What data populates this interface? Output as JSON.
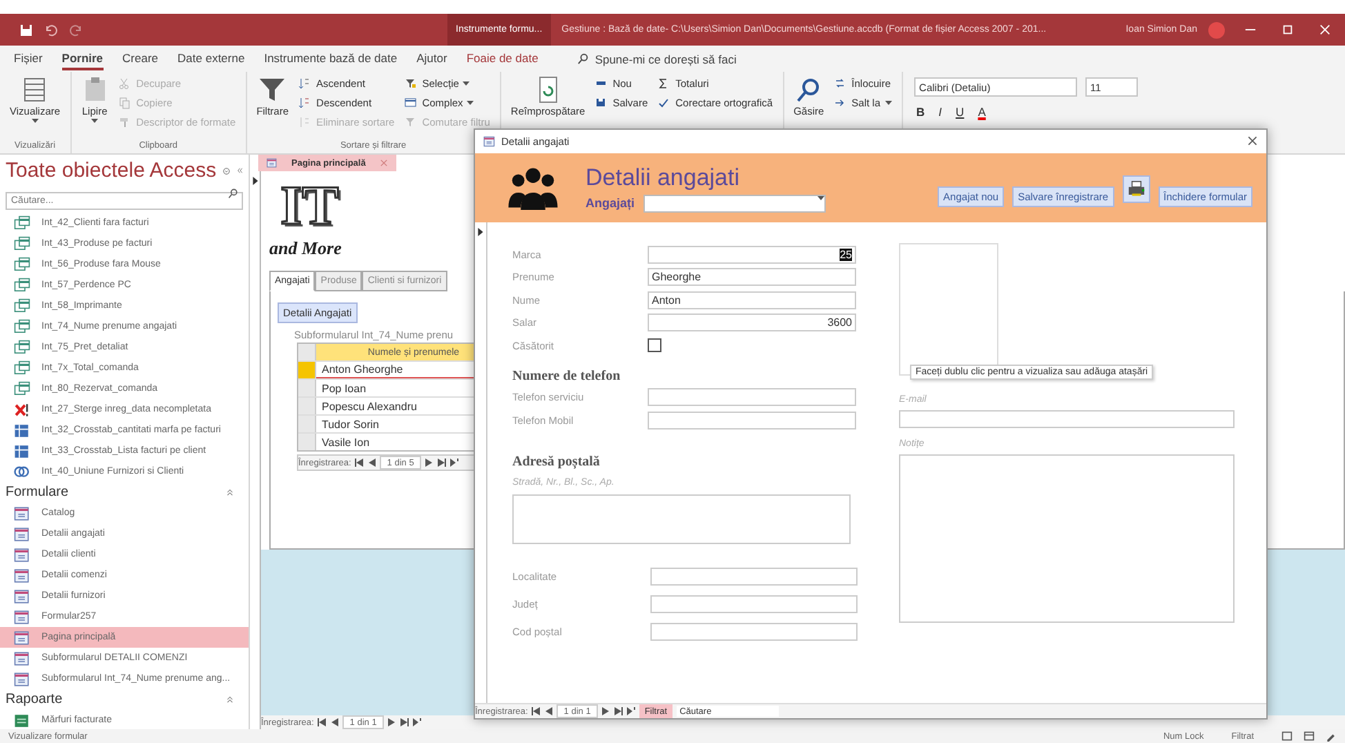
{
  "title_bar": {
    "context_tab": "Instrumente formu...",
    "title": "Gestiune : Bază de date- C:\\Users\\Simion Dan\\Documents\\Gestiune.accdb (Format de fișier Access 2007 - 201...",
    "user": "Ioan Simion Dan"
  },
  "ribbon_tabs": [
    {
      "label": "Fișier",
      "kind": "normal",
      "selected": false
    },
    {
      "label": "Pornire",
      "kind": "normal",
      "selected": true
    },
    {
      "label": "Creare",
      "kind": "normal",
      "selected": false
    },
    {
      "label": "Date externe",
      "kind": "normal",
      "selected": false
    },
    {
      "label": "Instrumente bază de date",
      "kind": "normal",
      "selected": false
    },
    {
      "label": "Ajutor",
      "kind": "normal",
      "selected": false
    },
    {
      "label": "Foaie de date",
      "kind": "contextual",
      "selected": false
    }
  ],
  "tell_me": {
    "placeholder": "Spune-mi ce dorești să faci"
  },
  "ribbon_groups": [
    {
      "label": "Vizualizări",
      "large": [
        {
          "label": "Vizualizare",
          "kind": "view",
          "dropdown": true,
          "disabled": false
        }
      ]
    },
    {
      "label": "Clipboard",
      "large": [
        {
          "label": "Lipire",
          "kind": "paste",
          "dropdown": true,
          "disabled": false
        }
      ],
      "columns": [
        [
          {
            "label": "Decupare",
            "kind": "cut",
            "dropdown": false,
            "disabled": true
          },
          {
            "label": "Copiere",
            "kind": "copy",
            "dropdown": false,
            "disabled": true
          },
          {
            "label": "Descriptor de formate",
            "kind": "brush",
            "dropdown": false,
            "disabled": true
          }
        ]
      ]
    },
    {
      "label": "Sortare și filtrare",
      "large": [
        {
          "label": "Filtrare",
          "kind": "filter",
          "dropdown": false,
          "disabled": false
        }
      ],
      "columns": [
        [
          {
            "label": "Ascendent",
            "kind": "sort-asc",
            "dropdown": false,
            "disabled": false
          },
          {
            "label": "Descendent",
            "kind": "sort-desc",
            "dropdown": false,
            "disabled": false
          },
          {
            "label": "Eliminare sortare",
            "kind": "clear-sort",
            "dropdown": false,
            "disabled": true
          }
        ],
        [
          {
            "label": "Selecție",
            "kind": "selection",
            "dropdown": true,
            "disabled": false
          },
          {
            "label": "Complex",
            "kind": "advanced",
            "dropdown": true,
            "disabled": false
          },
          {
            "label": "Comutare filtru",
            "kind": "toggle-filter",
            "dropdown": false,
            "disabled": true
          }
        ]
      ]
    },
    {
      "large": [
        {
          "label": "Reîmprospătare",
          "kind": "refresh",
          "dropdown": false,
          "disabled": false
        }
      ],
      "columns": [
        [
          {
            "label": "Nou",
            "kind": "new",
            "dropdown": false,
            "disabled": false
          },
          {
            "label": "Salvare",
            "kind": "save",
            "dropdown": false,
            "disabled": false
          }
        ],
        [
          {
            "label": "Totaluri",
            "kind": "totals",
            "dropdown": false,
            "disabled": false
          },
          {
            "label": "Corectare ortografică",
            "kind": "spelling",
            "dropdown": false,
            "disabled": false
          }
        ]
      ]
    },
    {
      "large": [
        {
          "label": "Găsire",
          "kind": "find",
          "dropdown": false,
          "disabled": false
        }
      ],
      "columns": [
        [
          {
            "label": "Înlocuire",
            "kind": "replace",
            "dropdown": false,
            "disabled": false
          },
          {
            "label": "Salt la",
            "kind": "goto",
            "dropdown": true,
            "disabled": false
          }
        ]
      ]
    }
  ],
  "text_format": {
    "font": "Calibri (Detaliu)",
    "size": "11",
    "buttons": [
      {
        "label": "B",
        "kind": "bold"
      },
      {
        "label": "I",
        "kind": "italic"
      },
      {
        "label": "U",
        "kind": "underline"
      },
      {
        "label": "A",
        "kind": "font-color"
      }
    ]
  },
  "nav_pane": {
    "title": "Toate obiectele Access",
    "search": {
      "placeholder": "Căutare..."
    },
    "sections": [
      {
        "items": [
          {
            "label": "Int_42_Clienti fara facturi",
            "kind": "query",
            "selected": false
          },
          {
            "label": "Int_43_Produse pe facturi",
            "kind": "query",
            "selected": false
          },
          {
            "label": "Int_56_Produse fara Mouse",
            "kind": "query",
            "selected": false
          },
          {
            "label": "Int_57_Perdence PC",
            "kind": "query",
            "selected": false
          },
          {
            "label": "Int_58_Imprimante",
            "kind": "query",
            "selected": false
          },
          {
            "label": "Int_74_Nume prenume angajati",
            "kind": "query",
            "selected": false
          },
          {
            "label": "Int_75_Pret_detaliat",
            "kind": "query",
            "selected": false
          },
          {
            "label": "Int_7x_Total_comanda",
            "kind": "query",
            "selected": false
          },
          {
            "label": "Int_80_Rezervat_comanda",
            "kind": "query",
            "selected": false
          },
          {
            "label": "Int_27_Sterge inreg_data necompletata",
            "kind": "delete",
            "selected": false
          },
          {
            "label": "Int_32_Crosstab_cantitati marfa pe facturi",
            "kind": "crosstab",
            "selected": false
          },
          {
            "label": "Int_33_Crosstab_Lista facturi pe client",
            "kind": "crosstab",
            "selected": false
          },
          {
            "label": "Int_40_Uniune Furnizori si Clienti",
            "kind": "union",
            "selected": false
          }
        ]
      },
      {
        "title": "Formulare",
        "items": [
          {
            "label": "Catalog",
            "kind": "form",
            "selected": false
          },
          {
            "label": "Detalii angajati",
            "kind": "form",
            "selected": false
          },
          {
            "label": "Detalii clienti",
            "kind": "form",
            "selected": false
          },
          {
            "label": "Detalii comenzi",
            "kind": "form",
            "selected": false
          },
          {
            "label": "Detalii furnizori",
            "kind": "form",
            "selected": false
          },
          {
            "label": "Formular257",
            "kind": "form",
            "selected": false
          },
          {
            "label": "Pagina principală",
            "kind": "form",
            "selected": true
          },
          {
            "label": "Subformularul DETALII COMENZI",
            "kind": "form",
            "selected": false
          },
          {
            "label": "Subformularul Int_74_Nume prenume ang...",
            "kind": "form",
            "selected": false
          }
        ]
      },
      {
        "title": "Rapoarte",
        "items": [
          {
            "label": "Mărfuri facturate",
            "kind": "report",
            "selected": false
          }
        ]
      }
    ]
  },
  "main": {
    "document_tab": "Pagina principală",
    "logo_text": "IT",
    "tagline": "and More",
    "form_tabs": [
      {
        "label": "Angajati",
        "selected": true
      },
      {
        "label": "Produse",
        "selected": false
      },
      {
        "label": "Clienti si furnizori",
        "selected": false
      }
    ],
    "details_button": "Detalii Angajati",
    "subform_label": "Subformularul Int_74_Nume prenu",
    "grid_header": "Numele și prenumele",
    "grid_rows": [
      {
        "name": "Anton Gheorghe",
        "selected": true
      },
      {
        "name": "Pop Ioan",
        "selected": false
      },
      {
        "name": "Popescu Alexandru",
        "selected": false
      },
      {
        "name": "Tudor Sorin",
        "selected": false
      },
      {
        "name": "Vasile Ion",
        "selected": false
      }
    ],
    "subform_nav": {
      "label": "Înregistrarea:",
      "position": "1 din 5"
    },
    "record_nav": {
      "label": "Înregistrarea:",
      "position": "1 din 1"
    }
  },
  "dialog": {
    "title": "Detalii angajati",
    "header_title": "Detalii angajati",
    "combo_label": "Angajați",
    "buttons": [
      {
        "label": "Angajat nou",
        "kind": "text"
      },
      {
        "label": "Salvare înregistrare",
        "kind": "text"
      },
      {
        "kind": "print"
      },
      {
        "label": "Închidere formular",
        "kind": "text"
      }
    ],
    "fields": [
      {
        "label": "Marca",
        "kind": "number",
        "value": "25",
        "text_selected": true
      },
      {
        "label": "Prenume",
        "kind": "text",
        "value": "Gheorghe",
        "text_selected": false
      },
      {
        "label": "Nume",
        "kind": "text",
        "value": "Anton",
        "text_selected": false
      },
      {
        "label": "Salar",
        "kind": "number",
        "value": "3600",
        "text_selected": false
      },
      {
        "label": "Căsătorit",
        "kind": "checkbox",
        "checked": false
      }
    ],
    "phone_heading": "Numere de telefon",
    "phone_fields": [
      {
        "label": "Telefon serviciu"
      },
      {
        "label": "Telefon Mobil"
      }
    ],
    "address_heading": "Adresă poștală",
    "street_label": "Stradă, Nr., Bl., Sc., Ap.",
    "address_fields": [
      {
        "label": "Localitate"
      },
      {
        "label": "Județ"
      },
      {
        "label": "Cod poștal"
      }
    ],
    "attachment_tooltip": "Faceți dublu clic pentru a vizualiza sau adăuga atașări",
    "email_label": "E-mail",
    "notes_label": "Notițe",
    "record_nav": {
      "label": "Înregistrarea:",
      "position": "1 din 1",
      "filter": "Filtrat",
      "filtered": true,
      "search": {
        "placeholder": "Căutare"
      }
    }
  },
  "status_bar": {
    "left": "Vizualizare formular",
    "indicators": [
      "Num Lock",
      "Filtrat"
    ]
  }
}
